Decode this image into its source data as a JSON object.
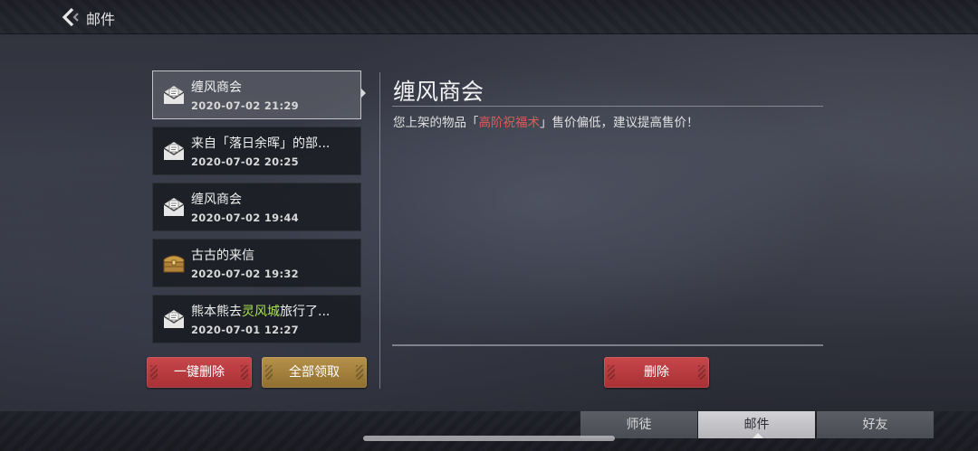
{
  "header": {
    "title": "邮件",
    "back_icon": "back-chevron-icon"
  },
  "mails": [
    {
      "name": "缠风商会",
      "date": "2020-07-02  21:29",
      "icon": "envelope-icon",
      "selected": true
    },
    {
      "name": "来自「落日余晖」的部...",
      "date": "2020-07-02  20:25",
      "icon": "envelope-icon",
      "selected": false
    },
    {
      "name": "缠风商会",
      "date": "2020-07-02  19:44",
      "icon": "envelope-icon",
      "selected": false
    },
    {
      "name": "古古的来信",
      "date": "2020-07-02  19:32",
      "icon": "treasure-chest-icon",
      "selected": false
    },
    {
      "name_pre": "熊本熊去",
      "name_hl": "灵风城",
      "name_post": "旅行了...",
      "date": "2020-07-01  12:27",
      "icon": "envelope-icon",
      "selected": false
    }
  ],
  "list_buttons": {
    "delete_all": "一键删除",
    "collect_all": "全部领取"
  },
  "detail": {
    "title": "缠风商会",
    "body_pre": "您上架的物品「",
    "body_item": "高阶祝福术",
    "body_post": "」售价偏低，建议提高售价！",
    "delete_label": "删除"
  },
  "tabs": [
    {
      "label": "师徒",
      "active": false
    },
    {
      "label": "邮件",
      "active": true
    },
    {
      "label": "好友",
      "active": false
    }
  ],
  "colors": {
    "red_button": "#b83a3e",
    "gold_button": "#a3823c",
    "highlight_red": "#e25a5a",
    "highlight_green": "#a7e14f"
  }
}
